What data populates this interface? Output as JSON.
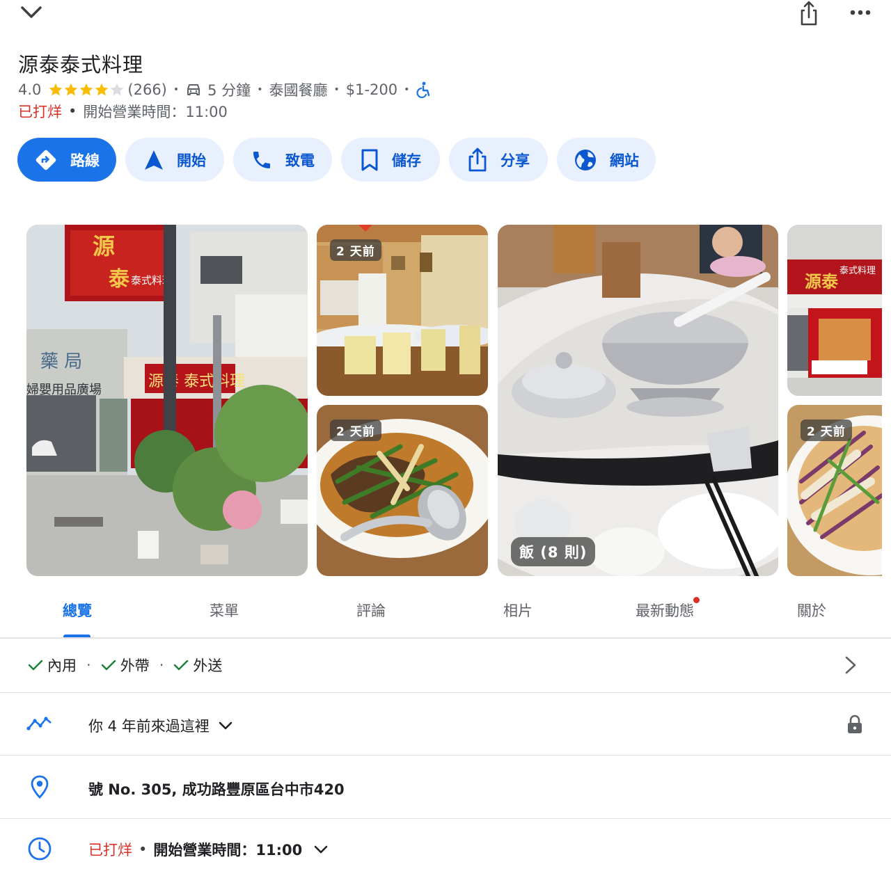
{
  "header": {
    "collapse_icon": "chevron-down-icon",
    "share_icon": "share-icon",
    "more_icon": "more-icon"
  },
  "place": {
    "name": "源泰泰式料理",
    "rating": "4.0",
    "rating_value": 4,
    "rating_max": 5,
    "review_count": "(266)",
    "drive_time": "5 分鐘",
    "category": "泰國餐廳",
    "price": "$1-200",
    "status": "已打烊",
    "hours": "開始營業時間：11:00",
    "colors": {
      "star": "#fbbc04",
      "closed": "#d93025",
      "accent": "#1a73e8"
    }
  },
  "actions": [
    {
      "label": "路線",
      "icon": "directions-icon"
    },
    {
      "label": "開始",
      "icon": "navigation-arrow-icon"
    },
    {
      "label": "致電",
      "icon": "phone-icon"
    },
    {
      "label": "儲存",
      "icon": "bookmark-icon"
    },
    {
      "label": "分享",
      "icon": "share-icon"
    },
    {
      "label": "網站",
      "icon": "globe-icon"
    }
  ],
  "photos": {
    "badge_recent": "2 天前",
    "badge_rice": "飯 (8 則)"
  },
  "tabs": [
    {
      "label": "總覽",
      "active": true
    },
    {
      "label": "菜單"
    },
    {
      "label": "評論"
    },
    {
      "label": "相片"
    },
    {
      "label": "最新動態",
      "has_update": true
    },
    {
      "label": "關於"
    }
  ],
  "services": [
    {
      "label": "內用"
    },
    {
      "label": "外帶"
    },
    {
      "label": "外送"
    }
  ],
  "visited": {
    "text": "你 4 年前來過這裡"
  },
  "address": {
    "text": "號 No. 305, 成功路豐原區台中市420"
  },
  "hours_row": {
    "status": "已打烊",
    "hours": "開始營業時間：11:00"
  }
}
